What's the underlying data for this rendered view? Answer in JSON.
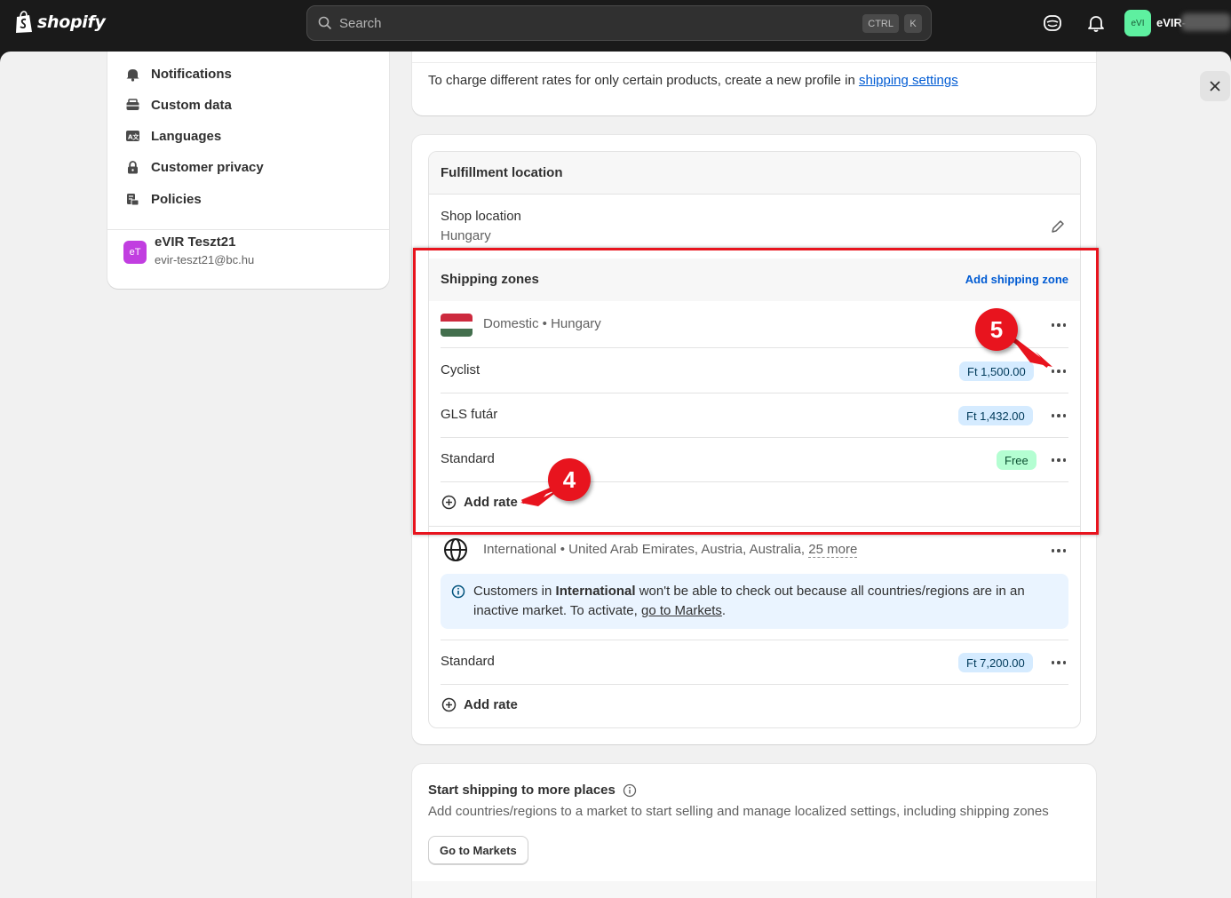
{
  "topbar": {
    "brand": "shopify",
    "search_placeholder": "Search",
    "shortcut_ctrl": "CTRL",
    "shortcut_k": "K",
    "avatar_initials": "eVI",
    "store_name": "eVIR-"
  },
  "sidebar": {
    "items": [
      {
        "label": "Notifications",
        "icon": "bell-icon"
      },
      {
        "label": "Custom data",
        "icon": "custom-data-icon"
      },
      {
        "label": "Languages",
        "icon": "language-icon"
      },
      {
        "label": "Customer privacy",
        "icon": "lock-icon"
      },
      {
        "label": "Policies",
        "icon": "policies-icon"
      }
    ],
    "account": {
      "initials": "eT",
      "name": "eVIR Teszt21",
      "email": "evir-teszt21@bc.hu"
    }
  },
  "profile_notice": {
    "text": "To charge different rates for only certain products, create a new profile in ",
    "link": "shipping settings"
  },
  "fulfillment": {
    "header": "Fulfillment location",
    "location_title": "Shop location",
    "location_country": "Hungary"
  },
  "zones": {
    "header": "Shipping zones",
    "add_zone": "Add shipping zone",
    "domestic": {
      "title": "Domestic • Hungary",
      "rates": [
        {
          "name": "Cyclist",
          "price": "Ft 1,500.00",
          "type": "blue"
        },
        {
          "name": "GLS futár",
          "price": "Ft 1,432.00",
          "type": "blue"
        },
        {
          "name": "Standard",
          "price": "Free",
          "type": "green"
        }
      ],
      "add_rate": "Add rate"
    },
    "international": {
      "title": "International • United Arab Emirates, Austria, Australia,",
      "more": "25 more",
      "banner_pre": "Customers in ",
      "banner_bold": "International",
      "banner_mid": " won't be able to check out because all countries/regions are in an inactive market. To activate, ",
      "banner_link": "go to Markets",
      "banner_post": ".",
      "rates": [
        {
          "name": "Standard",
          "price": "Ft 7,200.00",
          "type": "blue"
        }
      ],
      "add_rate": "Add rate"
    }
  },
  "markets": {
    "title": "Start shipping to more places",
    "description": "Add countries/regions to a market to start selling and manage localized settings, including shipping zones",
    "button": "Go to Markets"
  },
  "annotations": {
    "marker_4": "4",
    "marker_5": "5",
    "color": "#e8141e"
  },
  "flag_colors": [
    "#cd2a3e",
    "#ffffff",
    "#436f4d"
  ]
}
